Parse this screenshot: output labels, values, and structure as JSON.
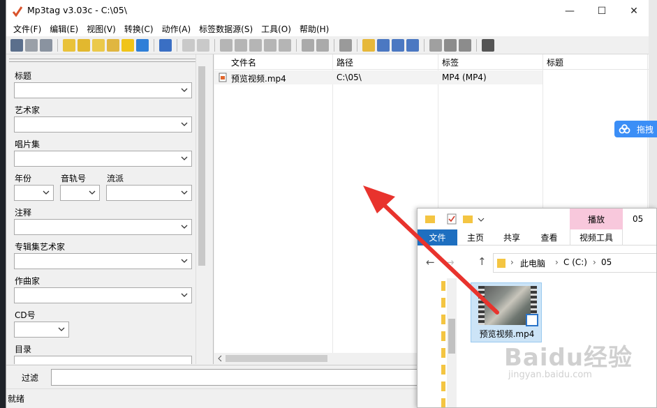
{
  "window": {
    "title": "Mp3tag v3.03c  -  C:\\05\\",
    "min_glyph": "—",
    "max_glyph": "☐",
    "close_glyph": "✕"
  },
  "menu": [
    "文件(F)",
    "编辑(E)",
    "视图(V)",
    "转换(C)",
    "动作(A)",
    "标签数据源(S)",
    "工具(O)",
    "帮助(H)"
  ],
  "tag_panel": {
    "title_label": "标题",
    "artist_label": "艺术家",
    "album_label": "唱片集",
    "year_label": "年份",
    "track_label": "音轨号",
    "genre_label": "流派",
    "comment_label": "注释",
    "album_artist_label": "专辑集艺术家",
    "composer_label": "作曲家",
    "cd_label": "CD号",
    "directory_label": "目录"
  },
  "file_list": {
    "columns": [
      "文件名",
      "路径",
      "标签",
      "标题"
    ],
    "rows": [
      {
        "filename": "预览视频.mp4",
        "path": "C:\\05\\",
        "tag": "MP4 (MP4)",
        "title": ""
      }
    ]
  },
  "filter": {
    "label": "过滤",
    "value": ""
  },
  "status": {
    "text": "就绪"
  },
  "cloud_chip": {
    "label": "拖拽"
  },
  "explorer": {
    "play_tab": "播放",
    "window_title": "05",
    "tabs": [
      "文件",
      "主页",
      "共享",
      "查看",
      "视频工具"
    ],
    "breadcrumb": [
      "此电脑",
      "C (C:)",
      "05"
    ],
    "file_name": "预览视频.mp4"
  },
  "watermark": {
    "main": "Baidu经验",
    "sub": "jingyan.baidu.com"
  },
  "colors": {
    "accent_blue": "#1e6fc0",
    "arrow_red": "#e8332d",
    "play_tab_pink": "#f8c8dc",
    "chip_blue": "#3b8ef6"
  }
}
